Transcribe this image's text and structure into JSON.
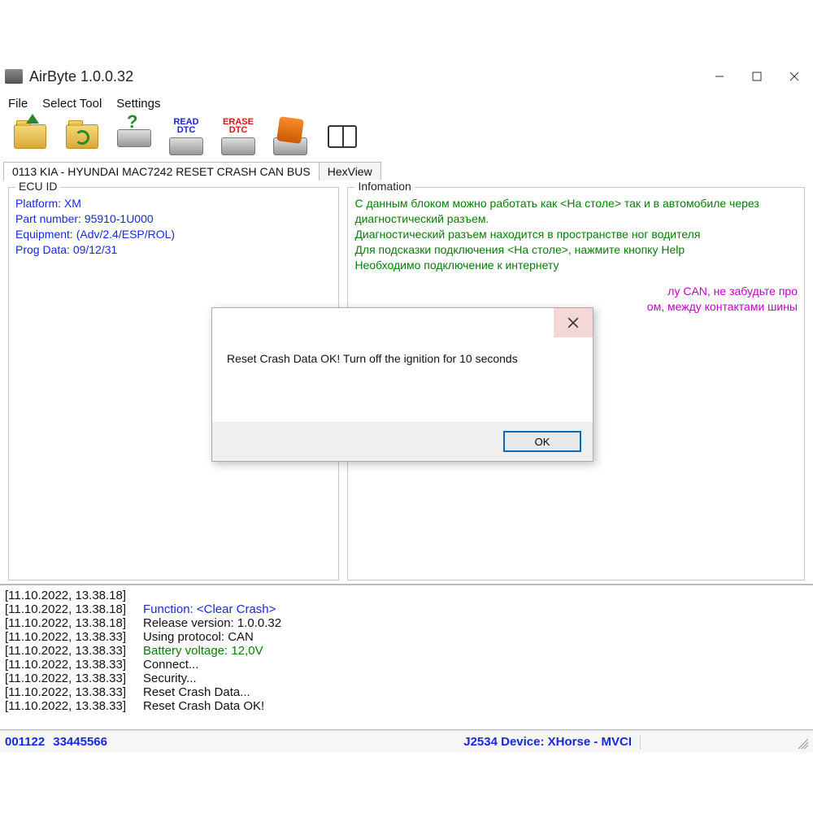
{
  "title": "AirByte  1.0.0.32",
  "menubar": {
    "file": "File",
    "select_tool": "Select Tool",
    "settings": "Settings"
  },
  "toolbar": {
    "open": "open-folder",
    "reload": "reload-folder",
    "help": "help",
    "read_dtc_l1": "READ",
    "read_dtc_l2": "DTC",
    "erase_dtc_l1": "ERASE",
    "erase_dtc_l2": "DTC",
    "write": "write",
    "manual": "manual"
  },
  "tabs": {
    "main": "0113 KIA - HYUNDAI MAC7242 RESET CRASH CAN BUS",
    "hex": "HexView"
  },
  "ecu": {
    "legend": "ECU ID",
    "platform": "Platform: XM",
    "part_number": "Part number: 95910-1U000",
    "equipment": "Equipment: (Adv/2.4/ESP/ROL)",
    "prog_data": "Prog Data: 09/12/31"
  },
  "info": {
    "legend": "Infomation",
    "l1": "С данным блоком можно работать как <На столе> так и в автомобиле через диагностический разъем.",
    "l2": "Диагностический разъем находится в пространстве ног водителя",
    "l3": "Для подсказки подключения <На столе>, нажмите кнопку Help",
    "l4": "Необходимо подключение к интернету",
    "m1": "лу CAN, не забудьте про",
    "m2": "ом, между контактами шины"
  },
  "log": [
    {
      "ts": "[11.10.2022, 13.38.18]",
      "msg": "",
      "cls": ""
    },
    {
      "ts": "[11.10.2022, 13.38.18]",
      "msg": "Function: <Clear Crash>",
      "cls": "blue"
    },
    {
      "ts": "[11.10.2022, 13.38.18]",
      "msg": "Release version: 1.0.0.32",
      "cls": ""
    },
    {
      "ts": "[11.10.2022, 13.38.33]",
      "msg": "Using protocol: CAN",
      "cls": ""
    },
    {
      "ts": "[11.10.2022, 13.38.33]",
      "msg": "Battery voltage: 12,0V",
      "cls": "green"
    },
    {
      "ts": "[11.10.2022, 13.38.33]",
      "msg": "Connect...",
      "cls": ""
    },
    {
      "ts": "[11.10.2022, 13.38.33]",
      "msg": "Security...",
      "cls": ""
    },
    {
      "ts": "[11.10.2022, 13.38.33]",
      "msg": "Reset Crash Data...",
      "cls": ""
    },
    {
      "ts": "[11.10.2022, 13.38.33]",
      "msg": "Reset Crash Data OK!",
      "cls": ""
    }
  ],
  "status": {
    "left1": "001122",
    "left2": "33445566",
    "device": "J2534 Device: XHorse - MVCI"
  },
  "dialog": {
    "message": "Reset Crash Data OK! Turn off the ignition for 10 seconds",
    "ok": "OK"
  }
}
